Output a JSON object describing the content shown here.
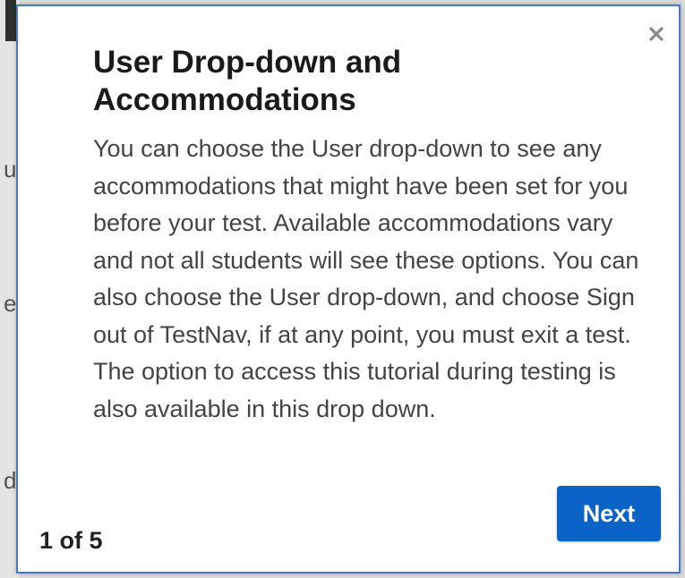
{
  "dialog": {
    "title": "User Drop-down and Accommodations",
    "body": "You can choose the User drop-down to see any accommodations that might have been set for you before your test. Available accommodations vary and not all students will see these options. You can also choose the User drop-down, and choose Sign out of TestNav, if at any point, you must exit a test. The option to access this tutorial during testing is also available in this drop down.",
    "close_icon": "close-icon",
    "next_label": "Next",
    "page_indicator": "1 of 5"
  },
  "background_fragments": [
    "u",
    "e",
    "d"
  ],
  "colors": {
    "border": "#4a78c2",
    "next_button": "#0b63c7",
    "close_icon": "#8a8a8a"
  }
}
